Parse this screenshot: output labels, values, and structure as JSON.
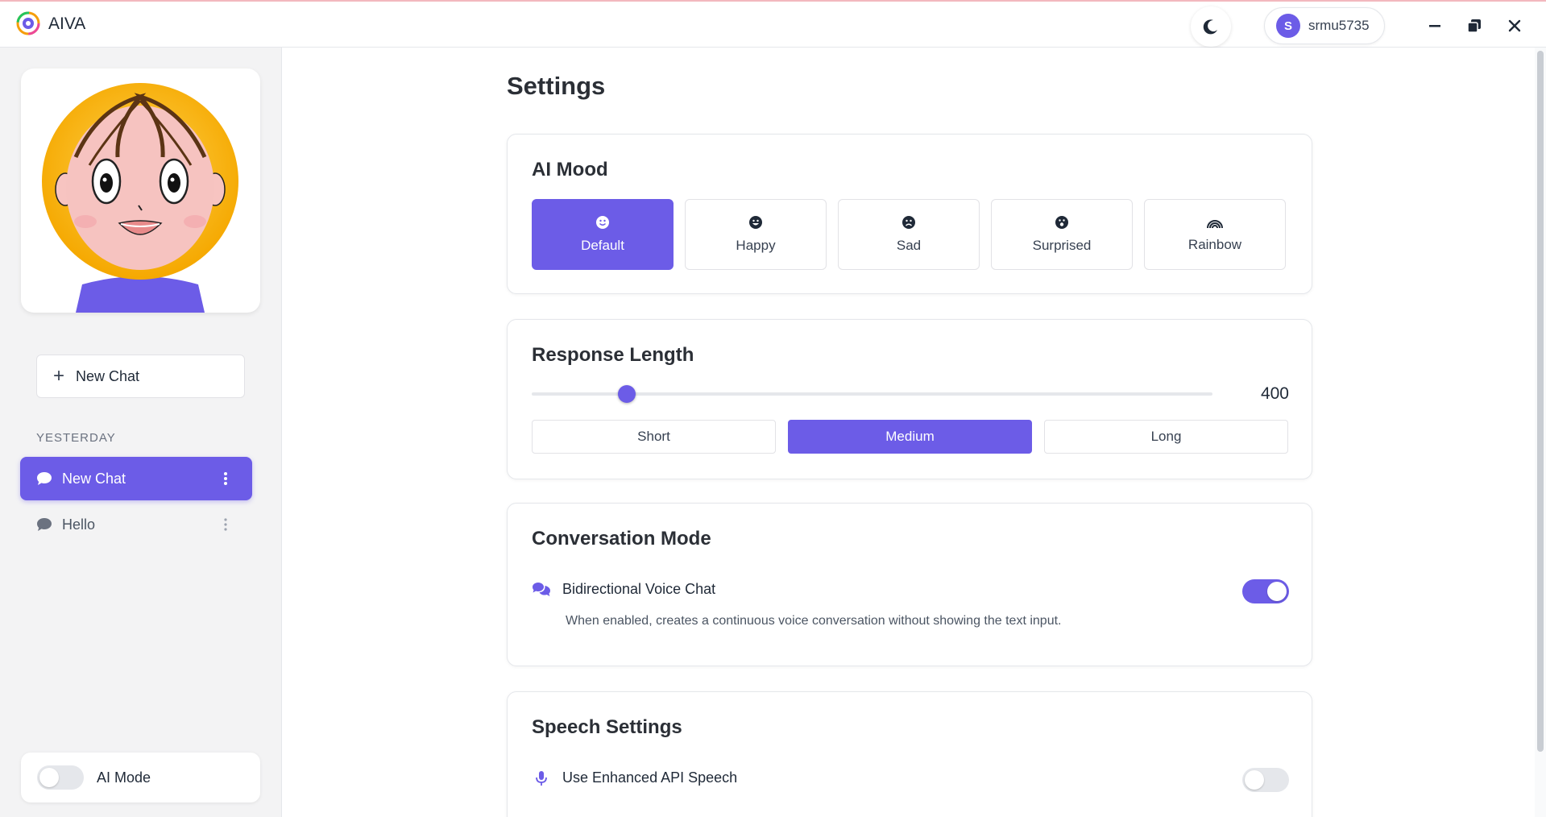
{
  "app": {
    "title": "AIVA"
  },
  "header": {
    "theme_icon": "moon-icon",
    "user": {
      "initial": "S",
      "name": "srmu5735"
    },
    "window_controls": [
      "minimize-icon",
      "restore-icon",
      "close-icon"
    ]
  },
  "sidebar": {
    "new_chat_label": "New Chat",
    "section_label": "YESTERDAY",
    "chats": [
      {
        "label": "New Chat",
        "active": true
      },
      {
        "label": "Hello",
        "active": false
      }
    ],
    "ai_mode": {
      "label": "AI Mode",
      "enabled": false
    }
  },
  "settings": {
    "title": "Settings",
    "mood": {
      "title": "AI Mood",
      "options": [
        {
          "label": "Default",
          "icon": "smile-icon",
          "active": true
        },
        {
          "label": "Happy",
          "icon": "grin-icon",
          "active": false
        },
        {
          "label": "Sad",
          "icon": "frown-icon",
          "active": false
        },
        {
          "label": "Surprised",
          "icon": "surprise-icon",
          "active": false
        },
        {
          "label": "Rainbow",
          "icon": "rainbow-icon",
          "active": false
        }
      ]
    },
    "response_length": {
      "title": "Response Length",
      "value": "400",
      "slider_fraction": 0.14,
      "options": [
        {
          "label": "Short",
          "active": false
        },
        {
          "label": "Medium",
          "active": true
        },
        {
          "label": "Long",
          "active": false
        }
      ]
    },
    "conversation": {
      "title": "Conversation Mode",
      "option_label": "Bidirectional Voice Chat",
      "option_desc": "When enabled, creates a continuous voice conversation without showing the text input.",
      "enabled": true
    },
    "speech": {
      "title": "Speech Settings",
      "option_label": "Use Enhanced API Speech",
      "enabled": false
    }
  },
  "colors": {
    "accent": "#6c5ce7"
  }
}
